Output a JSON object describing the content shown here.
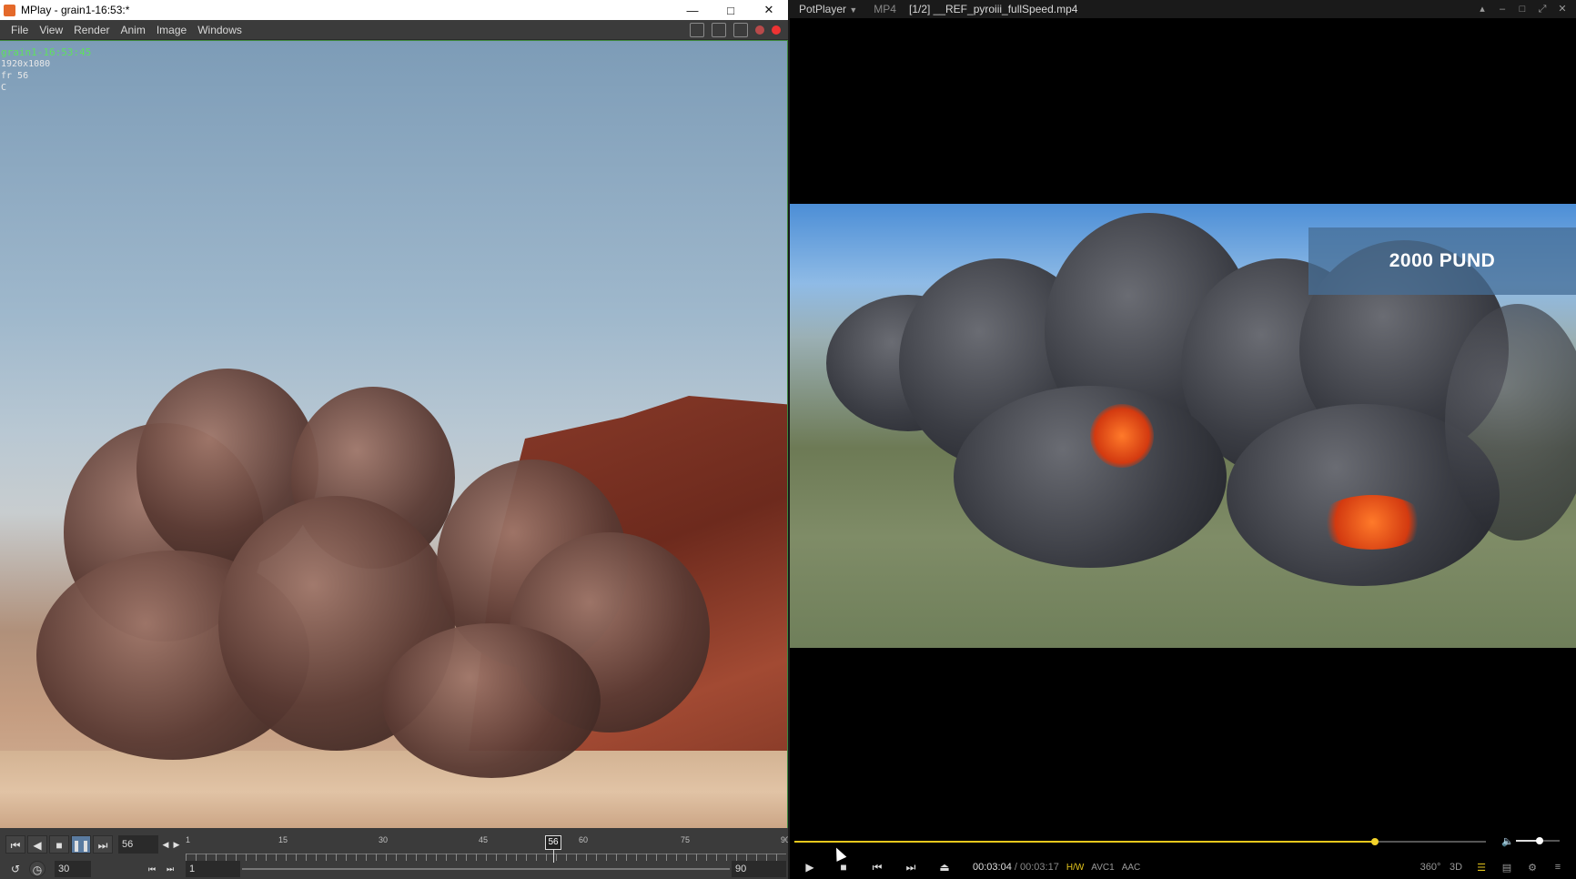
{
  "mplay": {
    "title": "MPlay - grain1-16:53:*",
    "menu": [
      "File",
      "View",
      "Render",
      "Anim",
      "Image",
      "Windows"
    ],
    "overlay": {
      "name": "grain1-16:53:45",
      "resolution": "1920x1080",
      "frame": "fr 56",
      "channel": "C"
    },
    "timeline": {
      "current_frame": "56",
      "fps": "30",
      "start": "1",
      "end": "90",
      "tick_labels": [
        "1",
        "15",
        "30",
        "45",
        "60",
        "75",
        "90"
      ],
      "cursor_label": "56"
    }
  },
  "potplayer": {
    "app": "PotPlayer",
    "format": "MP4",
    "file": "[1/2] __REF_pyroiii_fullSpeed.mp4",
    "caption": "2000 PUND",
    "time_current": "00:03:04",
    "time_sep": "/",
    "time_total": "00:03:17",
    "tags": [
      "H/W",
      "AVC1",
      "AAC"
    ],
    "right_controls": [
      "360°",
      "3D"
    ],
    "seek_progress": 0.84,
    "volume_level": 0.55
  },
  "colors": {
    "accent_yellow": "#e6c71c",
    "mplay_green_border": "#3f8a3f",
    "overlay_green": "#5fe05f"
  }
}
